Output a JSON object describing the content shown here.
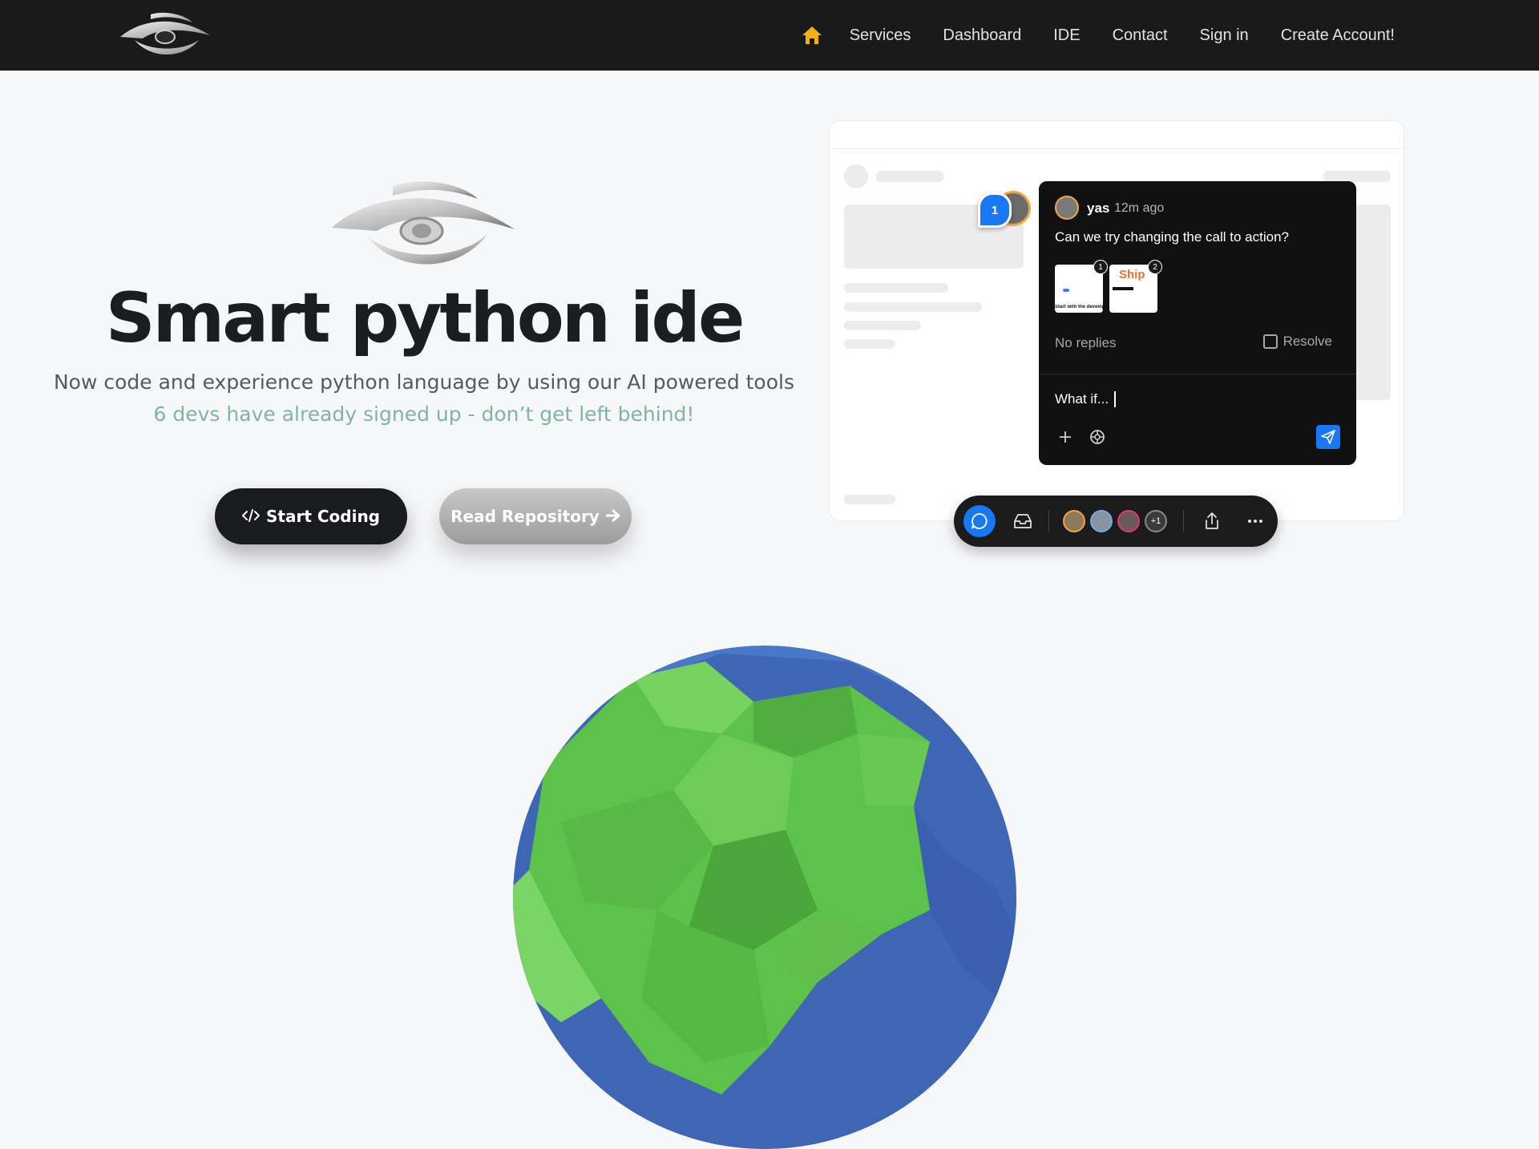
{
  "nav": {
    "home_icon": "home-icon",
    "links": [
      "Services",
      "Dashboard",
      "IDE",
      "Contact",
      "Sign in",
      "Create Account!"
    ]
  },
  "hero": {
    "title": "Smart python ide",
    "subtitle": "Now code and experience python language by using our AI powered tools",
    "note": "6 devs have already signed up - don’t get left behind!",
    "start_label": "Start Coding",
    "repo_label": "Read Repository"
  },
  "comment": {
    "pin_count": "1",
    "user": "yas",
    "time": "12m ago",
    "text": "Can we try changing the call to action?",
    "thumb1_badge": "1",
    "thumb2_badge": "2",
    "thumb2_text": "Ship",
    "thumb1_caption": "Start with the developer",
    "replies": "No replies",
    "resolve_label": "Resolve",
    "input_value": "What if..."
  },
  "toolbar": {
    "more_avatars": "+1"
  },
  "colors": {
    "accent_blue": "#1877f2",
    "note_green": "#7fb69d",
    "home_icon": "#f5b014"
  }
}
